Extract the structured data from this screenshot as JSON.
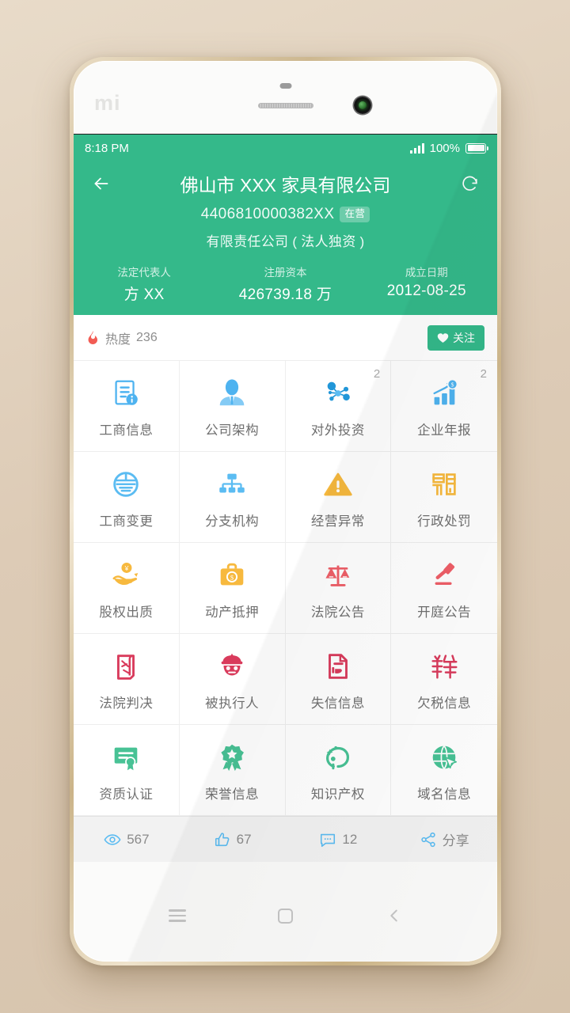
{
  "device": {
    "brand_logo": "mi"
  },
  "statusbar": {
    "time": "8:18 PM",
    "battery_percent": "100%",
    "signal_icon": "signal-bars-icon",
    "battery_icon": "battery-full-icon"
  },
  "header": {
    "back_icon": "back-arrow-icon",
    "refresh_icon": "refresh-icon",
    "title": "佛山市 XXX 家具有限公司",
    "reg_number": "4406810000382XX",
    "status_tag": "在营",
    "company_type": "有限责任公司 ( 法人独资 )",
    "accent_color": "#34b98a",
    "facts": [
      {
        "label": "法定代表人",
        "value": "方 XX"
      },
      {
        "label": "注册资本",
        "value": "426739.18 万"
      },
      {
        "label": "成立日期",
        "value": "2012-08-25"
      }
    ]
  },
  "heat": {
    "icon": "flame-icon",
    "label": "热度",
    "value": "236",
    "follow_icon": "heart-icon",
    "follow_label": "关注"
  },
  "grid": {
    "items": [
      {
        "label": "工商信息",
        "icon": "document-info-icon",
        "color": "#4eb3f0",
        "badge": ""
      },
      {
        "label": "公司架构",
        "icon": "person-business-icon",
        "color": "#4eb3f0",
        "badge": ""
      },
      {
        "label": "对外投资",
        "icon": "network-nodes-icon",
        "color": "#2196d8",
        "badge": "2"
      },
      {
        "label": "企业年报",
        "icon": "bar-chart-growth-icon",
        "color": "#4eb3f0",
        "badge": "2"
      },
      {
        "label": "工商变更",
        "icon": "circle-emblem-icon",
        "color": "#5bbcf2",
        "badge": ""
      },
      {
        "label": "分支机构",
        "icon": "org-tree-icon",
        "color": "#5bbcf2",
        "badge": ""
      },
      {
        "label": "经营异常",
        "icon": "warning-triangle-icon",
        "color": "#f7b93e",
        "badge": ""
      },
      {
        "label": "行政处罚",
        "icon": "penalty-seal-icon",
        "color": "#f7b93e",
        "badge": ""
      },
      {
        "label": "股权出质",
        "icon": "hand-coin-icon",
        "color": "#f7b93e",
        "badge": ""
      },
      {
        "label": "动产抵押",
        "icon": "briefcase-dollar-icon",
        "color": "#f7b93e",
        "badge": ""
      },
      {
        "label": "法院公告",
        "icon": "scales-justice-icon",
        "color": "#ef5f68",
        "badge": ""
      },
      {
        "label": "开庭公告",
        "icon": "gavel-icon",
        "color": "#ef5f68",
        "badge": ""
      },
      {
        "label": "法院判决",
        "icon": "verdict-scroll-icon",
        "color": "#d93b5c",
        "badge": ""
      },
      {
        "label": "被执行人",
        "icon": "police-officer-icon",
        "color": "#d93b5c",
        "badge": ""
      },
      {
        "label": "失信信息",
        "icon": "thumb-down-doc-icon",
        "color": "#d93b5c",
        "badge": ""
      },
      {
        "label": "欠税信息",
        "icon": "tax-character-icon",
        "color": "#d93b5c",
        "badge": ""
      },
      {
        "label": "资质认证",
        "icon": "certificate-icon",
        "color": "#48c295",
        "badge": ""
      },
      {
        "label": "荣誉信息",
        "icon": "award-ribbon-icon",
        "color": "#48c295",
        "badge": ""
      },
      {
        "label": "知识产权",
        "icon": "idea-swirl-icon",
        "color": "#48c295",
        "badge": ""
      },
      {
        "label": "域名信息",
        "icon": "globe-cursor-icon",
        "color": "#48c295",
        "badge": ""
      }
    ]
  },
  "actionbar": {
    "items": [
      {
        "icon": "eye-icon",
        "label": "567"
      },
      {
        "icon": "thumbs-up-icon",
        "label": "67"
      },
      {
        "icon": "comment-icon",
        "label": "12"
      },
      {
        "icon": "share-icon",
        "label": "分享"
      }
    ]
  },
  "navkeys": {
    "menu_icon": "menu-icon",
    "home_icon": "home-square-icon",
    "back_icon": "back-chevron-icon"
  }
}
